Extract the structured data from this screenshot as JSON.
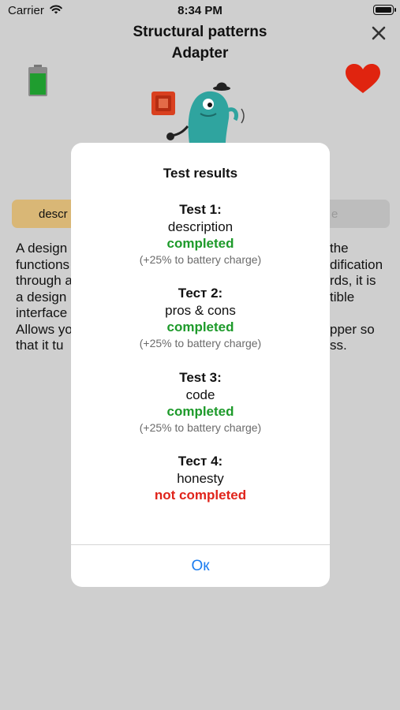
{
  "status_bar": {
    "carrier": "Carrier",
    "time": "8:34 PM"
  },
  "header": {
    "title_line1": "Structural patterns",
    "title_line2": "Adapter"
  },
  "icons": {
    "close": "close-icon",
    "battery_charge": "battery-charge-icon",
    "heart": "heart-icon",
    "mascot": "mascot-illustration"
  },
  "segments": {
    "left_visible": "descr",
    "right_visible": "e"
  },
  "body_text": [
    "A design",
    "functions",
    "through a",
    "a design",
    "interface",
    "Allows yo",
    "that it tu",
    "the",
    "dification",
    "rds, it is",
    "tible",
    "pper so",
    "ss."
  ],
  "alert": {
    "title": "Test results",
    "tests": [
      {
        "name": "Test 1:",
        "topic": "description",
        "status": "completed",
        "bonus": "(+25% to battery charge)"
      },
      {
        "name": "Тест 2:",
        "topic": "pros & cons",
        "status": "completed",
        "bonus": "(+25% to battery charge)"
      },
      {
        "name": "Test 3:",
        "topic": "code",
        "status": "completed",
        "bonus": "(+25% to battery charge)"
      },
      {
        "name": "Тест 4:",
        "topic": "honesty",
        "status": "not completed"
      }
    ],
    "ok_label": "Ок"
  },
  "colors": {
    "completed": "#1d9a2a",
    "not_completed": "#e0241b",
    "accent": "#1a7cf0",
    "battery_green": "#1f9d2f",
    "heart_red": "#e0240f"
  }
}
